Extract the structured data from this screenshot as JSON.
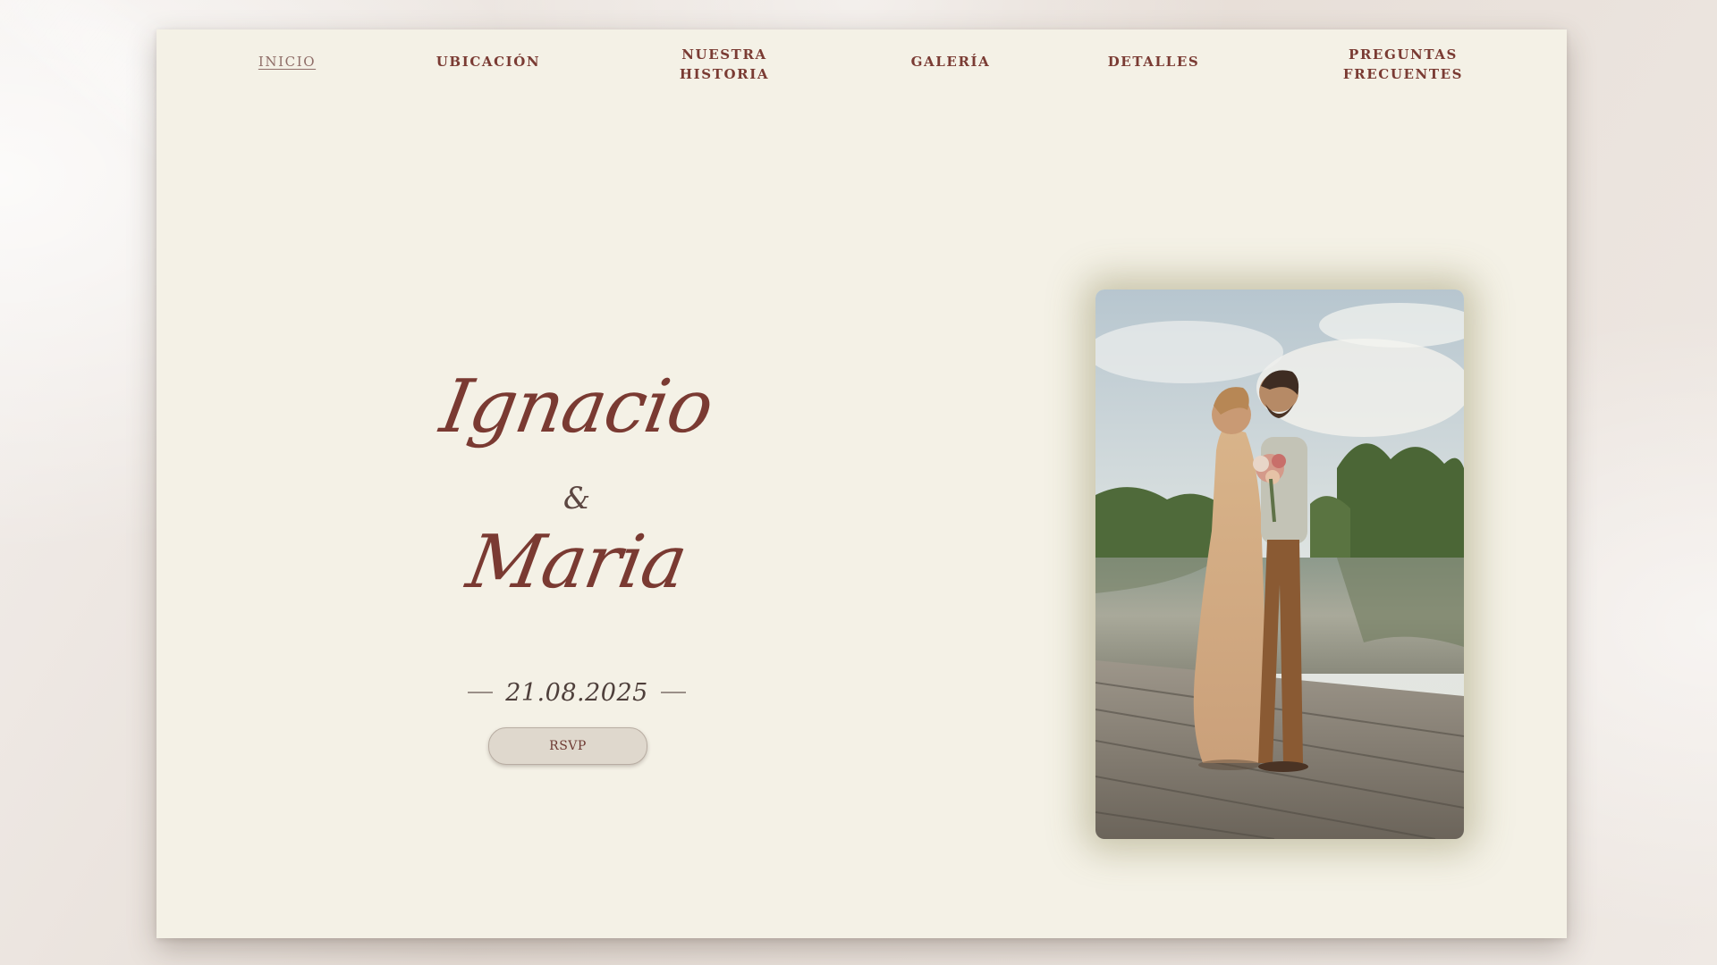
{
  "nav": {
    "items": [
      {
        "label": "INICIO",
        "active": true
      },
      {
        "label": "UBICACIÓN",
        "active": false
      },
      {
        "label": "NUESTRA\nHISTORIA",
        "active": false
      },
      {
        "label": "GALERÍA",
        "active": false
      },
      {
        "label": "DETALLES",
        "active": false
      },
      {
        "label": "PREGUNTAS\nFRECUENTES",
        "active": false
      }
    ]
  },
  "hero": {
    "name_1": "Ignacio",
    "ampersand": "&",
    "name_2": "Maria",
    "date": "21.08.2025",
    "rsvp_label": "RSVP"
  },
  "colors": {
    "page_background": "#f4f1e6",
    "accent": "#7a3b33",
    "button_background": "#dfd8cd"
  }
}
